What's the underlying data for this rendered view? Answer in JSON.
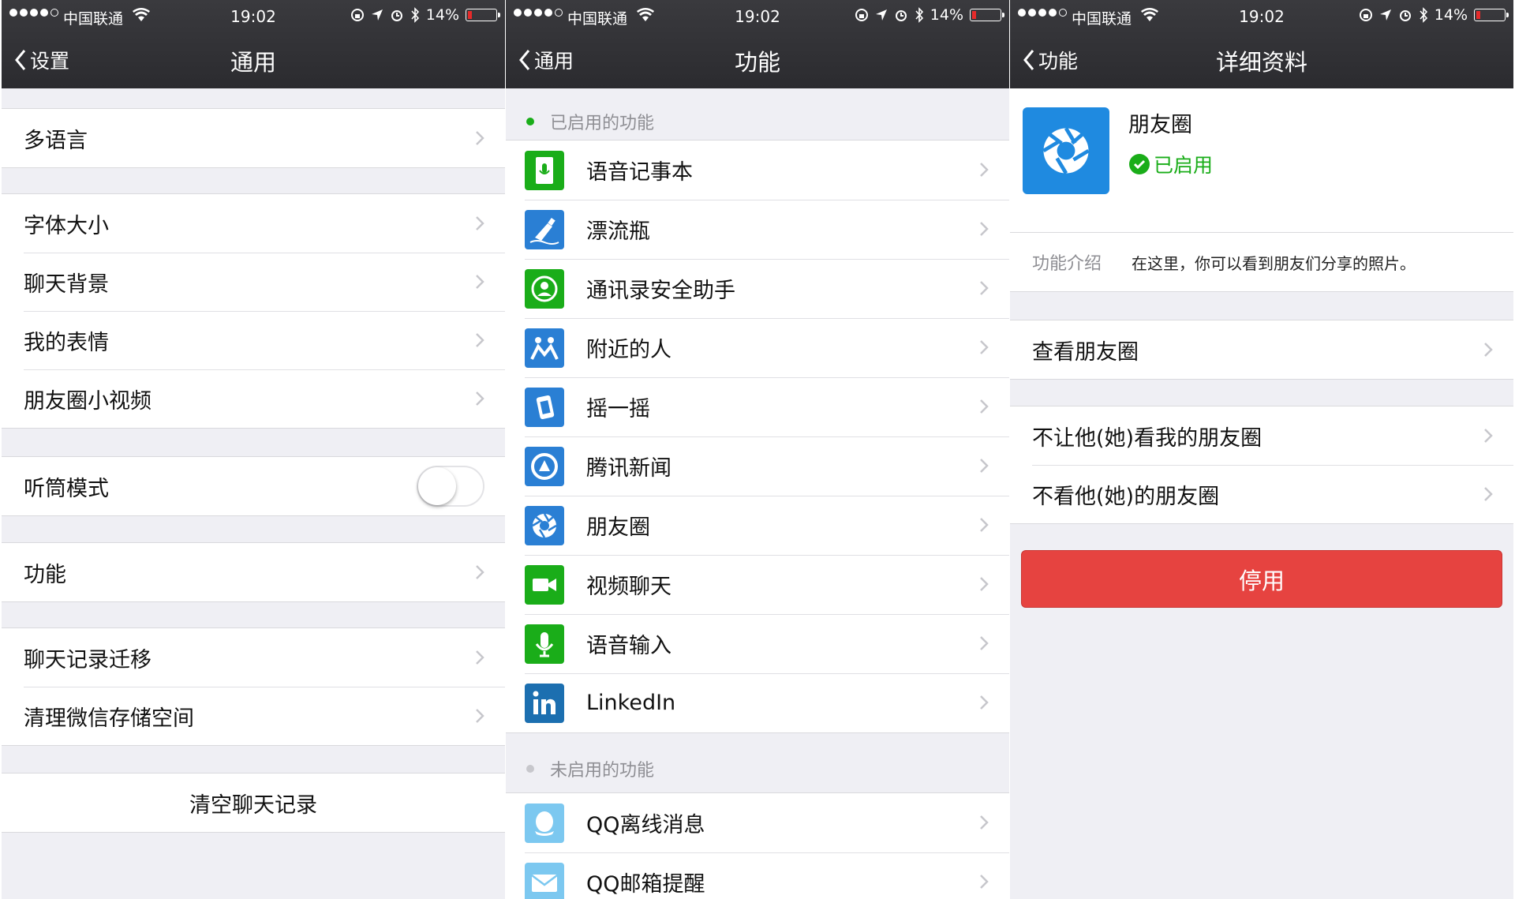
{
  "status_bar": {
    "carrier": "中国联通",
    "time": "19:02",
    "battery": "14%"
  },
  "screen1": {
    "back_label": "设置",
    "title": "通用",
    "groups": [
      [
        "多语言"
      ],
      [
        "字体大小",
        "聊天背景",
        "我的表情",
        "朋友圈小视频"
      ],
      [
        "听筒模式"
      ],
      [
        "功能"
      ],
      [
        "聊天记录迁移",
        "清理微信存储空间"
      ],
      [
        "清空聊天记录"
      ]
    ]
  },
  "screen2": {
    "back_label": "通用",
    "title": "功能",
    "enabled_header": "已启用的功能",
    "enabled": [
      {
        "label": "语音记事本",
        "icon": "voice-notepad-icon",
        "color": "#1aad19"
      },
      {
        "label": "漂流瓶",
        "icon": "drift-bottle-icon",
        "color": "#2a7fd4"
      },
      {
        "label": "通讯录安全助手",
        "icon": "contacts-security-icon",
        "color": "#1aad19"
      },
      {
        "label": "附近的人",
        "icon": "people-nearby-icon",
        "color": "#2a7fd4"
      },
      {
        "label": "摇一摇",
        "icon": "shake-icon",
        "color": "#2a7fd4"
      },
      {
        "label": "腾讯新闻",
        "icon": "tencent-news-icon",
        "color": "#2a7fd4"
      },
      {
        "label": "朋友圈",
        "icon": "moments-icon",
        "color": "#2a7fd4"
      },
      {
        "label": "视频聊天",
        "icon": "video-chat-icon",
        "color": "#1aad19"
      },
      {
        "label": "语音输入",
        "icon": "voice-input-icon",
        "color": "#1aad19"
      },
      {
        "label": "LinkedIn",
        "icon": "linkedin-icon",
        "color": "#1c6fb0"
      }
    ],
    "disabled_header": "未启用的功能",
    "disabled": [
      {
        "label": "QQ离线消息",
        "icon": "qq-offline-icon",
        "color": "#7cc8f0"
      },
      {
        "label": "QQ邮箱提醒",
        "icon": "qq-mail-icon",
        "color": "#7cc8f0"
      }
    ]
  },
  "screen3": {
    "back_label": "功能",
    "title": "详细资料",
    "name": "朋友圈",
    "status": "已启用",
    "intro_label": "功能介绍",
    "intro_text": "在这里，你可以看到朋友们分享的照片。",
    "view_label": "查看朋友圈",
    "privacy": [
      "不让他(她)看我的朋友圈",
      "不看他(她)的朋友圈"
    ],
    "disable_button": "停用"
  }
}
